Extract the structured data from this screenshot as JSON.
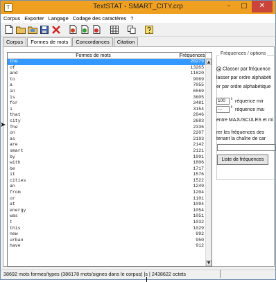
{
  "window": {
    "title": "TextSTAT - SMART_CITY.crp",
    "app_icon": "T",
    "minimize_glyph": "–",
    "maximize_glyph": "□",
    "close_glyph": "✕"
  },
  "menu": [
    "Corpus",
    "Exporter",
    "Langage",
    "Codage des caractères",
    "?"
  ],
  "toolbar": [
    {
      "name": "new-document-icon"
    },
    {
      "name": "open-folder-icon"
    },
    {
      "name": "open-folder-alt-icon"
    },
    {
      "name": "save-icon"
    },
    {
      "name": "delete-icon"
    },
    {
      "name": "add-file-icon"
    },
    {
      "name": "add-files-icon"
    },
    {
      "name": "remove-file-icon"
    },
    {
      "name": "grid-icon"
    },
    {
      "name": "copy-icon"
    },
    {
      "name": "help-icon"
    }
  ],
  "tabs": [
    {
      "label": "Corpus",
      "active": false
    },
    {
      "label": "Formes de mots",
      "active": true
    },
    {
      "label": "Concordances",
      "active": false
    },
    {
      "label": "Citation",
      "active": false
    }
  ],
  "wordlist": {
    "col_words": "Formes de mots",
    "col_freq": "Fréquences",
    "rows": [
      {
        "word": "the",
        "freq": "20279"
      },
      {
        "word": "of",
        "freq": "13265"
      },
      {
        "word": "and",
        "freq": "11820"
      },
      {
        "word": "to",
        "freq": "9069"
      },
      {
        "word": "a",
        "freq": "7055"
      },
      {
        "word": "in",
        "freq": "6569"
      },
      {
        "word": "is",
        "freq": "3605"
      },
      {
        "word": "for",
        "freq": "3481"
      },
      {
        "word": "i",
        "freq": "3154"
      },
      {
        "word": "that",
        "freq": "2946"
      },
      {
        "word": "city",
        "freq": "2683"
      },
      {
        "word": "The",
        "freq": "2336"
      },
      {
        "word": "on",
        "freq": "2207"
      },
      {
        "word": "as",
        "freq": "2193"
      },
      {
        "word": "are",
        "freq": "2142"
      },
      {
        "word": "smart",
        "freq": "2121"
      },
      {
        "word": "by",
        "freq": "1991"
      },
      {
        "word": "with",
        "freq": "1806"
      },
      {
        "word": "be",
        "freq": "1717"
      },
      {
        "word": "it",
        "freq": "1576"
      },
      {
        "word": "cities",
        "freq": "1522"
      },
      {
        "word": "an",
        "freq": "1249"
      },
      {
        "word": "from",
        "freq": "1204"
      },
      {
        "word": "or",
        "freq": "1101"
      },
      {
        "word": "at",
        "freq": "1094"
      },
      {
        "word": "energy",
        "freq": "1054"
      },
      {
        "word": "was",
        "freq": "1051"
      },
      {
        "word": "t",
        "freq": "1032"
      },
      {
        "word": "this",
        "freq": "1029"
      },
      {
        "word": "new",
        "freq": "992"
      },
      {
        "word": "urban",
        "freq": "950"
      },
      {
        "word": "have",
        "freq": "912"
      }
    ],
    "scroll_up_glyph": "▲",
    "scroll_down_glyph": "▼"
  },
  "options": {
    "legend": "Fréquences / options",
    "sort_by_frequency": "Classer par fréquence",
    "sort_alpha": "lasser par ordre alphabéti",
    "sort_alpha_reverse": "er par ordre alphabétique",
    "min_value": "100",
    "min_label": "réquence mir",
    "max_value": "---",
    "max_label": "réquence ma:",
    "case_label": "entre MAJUSCULES et mi",
    "filter_line1": "rer les fréquences des",
    "filter_line2": "tenant la chaîne de car",
    "filter_value": "",
    "button_label": "Liste de fréquences",
    "spin_glyph": "⇕"
  },
  "status": {
    "text": "38692 mots formes/types (386178 mots/signes dans le corpus) |s | 2438622 octets"
  },
  "pointer_glyph": "➤",
  "colors": {
    "title_bar": "#f0a020",
    "selection": "#3399ff",
    "close_button": "#c9443a"
  }
}
